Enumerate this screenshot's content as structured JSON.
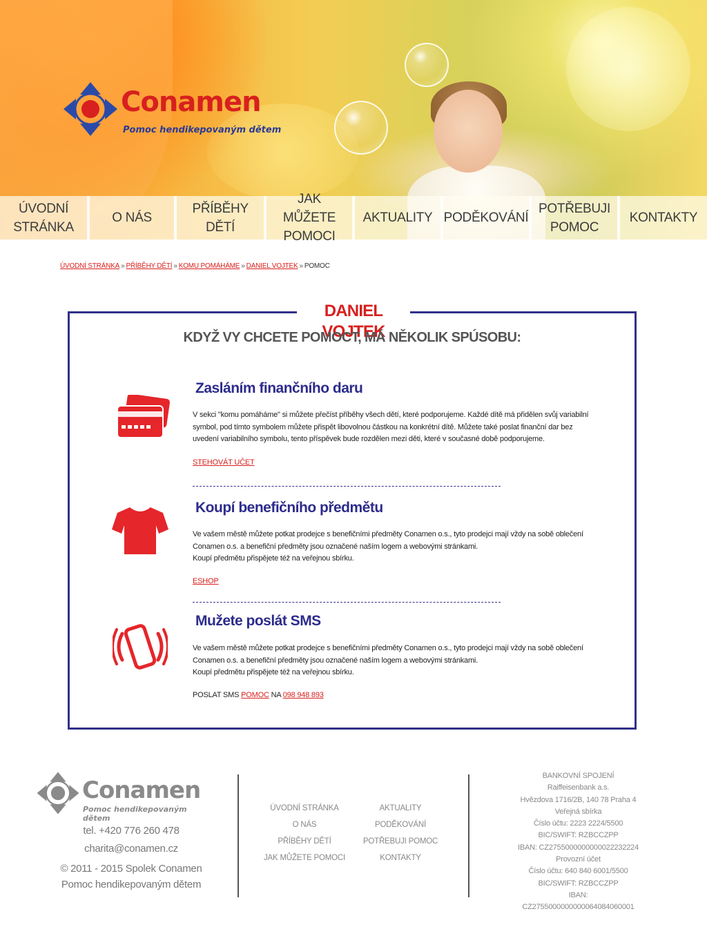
{
  "header": {
    "logo_name": "Conamen",
    "logo_tagline": "Pomoc hendikepovaným dětem"
  },
  "nav": {
    "items": [
      {
        "label": "ÚVODNÍ STRÁNKA"
      },
      {
        "label": "O NÁS"
      },
      {
        "label": "PŘÍBĚHY DĚTÍ"
      },
      {
        "label": "JAK MŮŽETE POMOCI"
      },
      {
        "label": "AKTUALITY"
      },
      {
        "label": "PODĚKOVÁNÍ"
      },
      {
        "label": "POTŘEBUJI POMOC"
      },
      {
        "label": "KONTAKTY"
      }
    ]
  },
  "breadcrumb": {
    "items": [
      "ÚVODNÍ STRÁNKA",
      "PŘÍBĚHY DĚTÍ",
      "KOMU POMÁHÁME",
      "DANIEL VOJTEK"
    ],
    "separator": "»",
    "current": "POMOC"
  },
  "main": {
    "title": "DANIEL VOJTEK",
    "subtitle": "KDYŽ VY CHCETE POMOCT, MÁ NĚKOLIK SPÚSOBU:",
    "sections": [
      {
        "title": "Zasláním finančního daru",
        "icon": "credit-card-icon",
        "text": "V sekci \"komu pomáháme\" si můžete přečíst příběhy všech dětí, které podporujeme. Každé dítě má přidělen svůj variabilní symbol, pod tímto symbolem můžete přispět libovolnou částkou na konkrétní dítě. Můžete také poslat finanční dar bez uvedení variabilního symbolu, tento příspěvek bude rozdělen  mezi děti, které v současné době podporujeme.",
        "link": "STEHOVÁT UČET"
      },
      {
        "title": "Koupí benefičního předmětu",
        "icon": "tshirt-icon",
        "text_lines": [
          "Ve vašem městě můžete potkat prodejce s benefičními předměty Conamen o.s., tyto prodejci mají vždy na sobě oblečení",
          "Conamen o.s. a benefiční předměty jsou označené naším logem a webovými stránkami.",
          "Koupí předmětu přispějete též na veřejnou sbírku."
        ],
        "link": "ESHOP"
      },
      {
        "title": "Mužete poslát SMS",
        "icon": "vibrating-phone-icon",
        "text_lines": [
          "Ve vašem městě můžete potkat prodejce s benefičními předměty Conamen o.s., tyto prodejci mají vždy na sobě oblečení",
          "Conamen o.s. a benefiční předměty jsou označené naším logem a webovými stránkami.",
          "Koupí předmětu přispějete též na veřejnou sbírku."
        ],
        "sms_prefix": "POSLAT SMS",
        "sms_keyword": "POMOC",
        "sms_middle": "NA",
        "sms_number": "098 948 893"
      }
    ]
  },
  "footer": {
    "logo_name": "Conamen",
    "logo_tagline": "Pomoc hendikepovaným dětem",
    "phone": "tel. +420 776 260 478",
    "email": "charita@conamen.cz",
    "copyright": "© 2011 - 2015 Spolek Conamen",
    "org": "Pomoc hendikepovaným dětem",
    "menu_left": [
      "ÚVODNÍ STRÁNKA",
      "O NÁS",
      "PŘÍBĚHY DĚTÍ",
      "JAK MŮŽETE POMOCI"
    ],
    "menu_right": [
      "AKTUALITY",
      "PODĚKOVÁNÍ",
      "POTŘEBUJI POMOC",
      "KONTAKTY"
    ],
    "bank": [
      "BANKOVNÍ SPOJENÍ",
      "Raiffeisenbank a.s.",
      "Hvězdova 1716/2B, 140 78 Praha 4",
      "Veřejná sbírka",
      "Číslo účtu: 2223 2224/5500",
      "BIC/SWIFT: RZBCCZPP",
      "IBAN: CZ2755000000000022232224",
      "Provozní účet",
      "Číslo účtu: 640 840 6001/5500",
      "BIC/SWIFT: RZBCCZPP",
      "IBAN: CZ2755000000000064084060001"
    ]
  },
  "colors": {
    "accent_red": "#d8201f",
    "brand_blue": "#2d2c8c",
    "box_border": "#31308a"
  }
}
